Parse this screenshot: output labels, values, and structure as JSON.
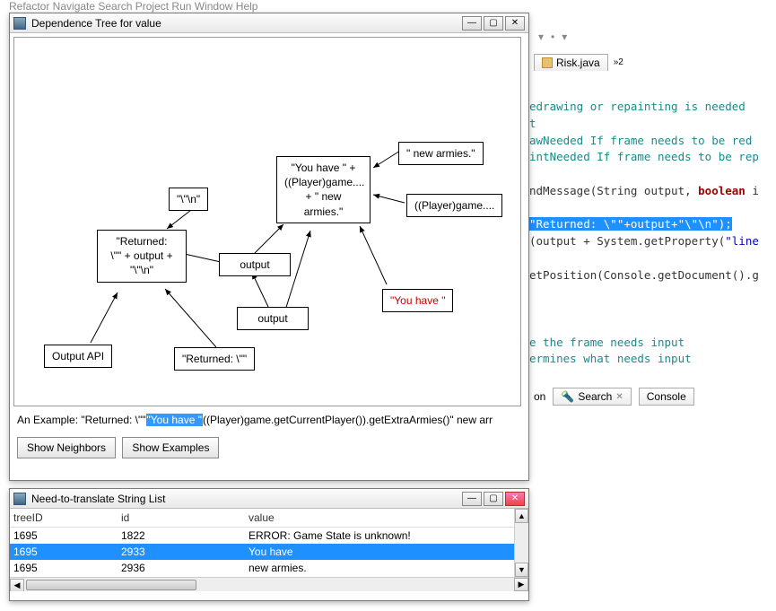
{
  "topMenu": "Refactor   Navigate   Search   Project   Run   Window   Help",
  "toolbar": {
    "arrow1": "▾",
    "dot": "•",
    "arrow2": "▾"
  },
  "editor": {
    "tab": {
      "label": "Risk.java"
    },
    "more": "»2",
    "code": {
      "l1a": "edrawing or repainting is needed",
      "l2": "t",
      "l3a": "awNeeded If frame needs to be red",
      "l4a": "intNeeded If frame needs to be rep",
      "l5a": "ndMessage(String output, ",
      "l5b": "boolean",
      "l5c": " i",
      "l6": "\"Returned: \\\"\"+output+\"\\\"\\n\");",
      "l7a": "(output + System.getProperty(",
      "l7b": "\"line",
      "l8": "etPosition(Console.getDocument().g",
      "l9": "e the frame needs input",
      "l10": "ermines what needs input"
    }
  },
  "bottomTabs": {
    "left": "on",
    "search": "Search",
    "console": "Console"
  },
  "depWindow": {
    "title": "Dependence Tree for value",
    "nodes": {
      "newArmies": "\" new armies.\"",
      "youHaveBlock": "\"You have \" +\n((Player)game....\n+ \" new\narmies.\"",
      "playerGame": "((Player)game....",
      "slashN": "\"\\\"\\n\"",
      "returnedBlock": "\"Returned:\n\\\"\" + output +\n\"\\\"\\n\"",
      "output1": "output",
      "output2": "output",
      "youHaveRed": "\"You have \"",
      "outputApi": "Output API",
      "returnedSmall": "\"Returned: \\\"\""
    },
    "example": {
      "prefix": "An Example: \"Returned: \\\"\"",
      "highlighted": "\"You have \"",
      "suffix": "((Player)game.getCurrentPlayer()).getExtraArmies()\" new arr"
    },
    "buttons": {
      "neighbors": "Show Neighbors",
      "examples": "Show Examples"
    }
  },
  "listWindow": {
    "title": "Need-to-translate String List",
    "headers": {
      "treeId": "treeID",
      "id": "id",
      "value": "value"
    },
    "rows": [
      {
        "treeId": "1695",
        "id": "1822",
        "value": "ERROR: Game State is unknown!"
      },
      {
        "treeId": "1695",
        "id": "2933",
        "value": "You have"
      },
      {
        "treeId": "1695",
        "id": "2936",
        "value": "new armies."
      }
    ]
  }
}
